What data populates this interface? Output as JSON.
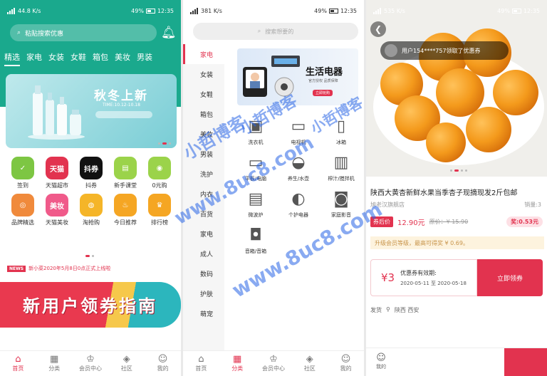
{
  "status": {
    "net": "4G",
    "speed": "44.8 K/s",
    "battery": "49%",
    "time": "12:35",
    "p2_speed": "381 K/s",
    "p3_speed": "535 K/s"
  },
  "home": {
    "search_placeholder": "粘贴搜索优惠",
    "categories": [
      "精选",
      "家电",
      "女装",
      "女鞋",
      "箱包",
      "美妆",
      "男装"
    ],
    "banner_title": "秋冬上新",
    "banner_sub": "TIME:10.12-10.18",
    "icons": [
      {
        "label": "签到",
        "glyph": "✓",
        "color": "#7dc643"
      },
      {
        "label": "天猫超市",
        "glyph": "天猫",
        "color": "#e2334f"
      },
      {
        "label": "抖券",
        "glyph": "抖券",
        "color": "#111111"
      },
      {
        "label": "新手课堂",
        "glyph": "▤",
        "color": "#9bd34a"
      },
      {
        "label": "0元购",
        "glyph": "◉",
        "color": "#9bd34a"
      },
      {
        "label": "品牌精选",
        "glyph": "◎",
        "color": "#f08a3c"
      },
      {
        "label": "天猫美妆",
        "glyph": "美妆",
        "color": "#f05a8a"
      },
      {
        "label": "淘抢购",
        "glyph": "◍",
        "color": "#f5b528"
      },
      {
        "label": "今日推荐",
        "glyph": "♨",
        "color": "#f5a623"
      },
      {
        "label": "排行榜",
        "glyph": "♛",
        "color": "#f5a623"
      }
    ],
    "news_badge": "NEWS",
    "news_text": "新小菜2020年5月8日0点正式上线啦",
    "guide_banner": "新用户领券指南"
  },
  "tabs": [
    {
      "label": "首页",
      "icon": "home-icon",
      "glyph": "⌂"
    },
    {
      "label": "分类",
      "icon": "grid-icon",
      "glyph": "▦"
    },
    {
      "label": "会员中心",
      "icon": "crown-icon",
      "glyph": "♔"
    },
    {
      "label": "社区",
      "icon": "community-icon",
      "glyph": "◈"
    },
    {
      "label": "我的",
      "icon": "user-icon",
      "glyph": "☺"
    }
  ],
  "category": {
    "search_placeholder": "搜索想要的",
    "sidebar": [
      "家电",
      "女装",
      "女鞋",
      "箱包",
      "美妆",
      "男装",
      "洗护",
      "内衣",
      "百货",
      "家电",
      "成人",
      "数码",
      "护肤",
      "萌宠"
    ],
    "banner_title": "生活电器",
    "banner_sub": "官方授权 品质保障",
    "banner_button": "立即抢购",
    "products": [
      {
        "label": "洗衣机",
        "glyph": "▣"
      },
      {
        "label": "电视机",
        "glyph": "▭"
      },
      {
        "label": "冰箱",
        "glyph": "▯"
      },
      {
        "label": "平板/电脑",
        "glyph": "▭"
      },
      {
        "label": "养生/水壶",
        "glyph": "◒"
      },
      {
        "label": "榨汁/搅拌机",
        "glyph": "▥"
      },
      {
        "label": "微波炉",
        "glyph": "▤"
      },
      {
        "label": "个护电器",
        "glyph": "◐"
      },
      {
        "label": "家庭影音",
        "glyph": "◙"
      },
      {
        "label": "音箱/音箱",
        "glyph": "◘"
      }
    ]
  },
  "detail": {
    "toast": "用户154****757领取了优惠券",
    "title": "陕西大黄杏新鲜水果当季杏子现摘现发2斤包邮",
    "shop": "旭老汉旗舰店",
    "sold": "销量:3",
    "price_tag": "券后价",
    "price_now": "12.90元",
    "price_old": "原价：¥ 15.90",
    "reward": "奖:0.53元",
    "upgrade": "升级会员等级，最高可得奖 ¥ 0.69。",
    "coupon_amount": "¥3",
    "coupon_label": "优惠券有效期:",
    "coupon_dates": "2020-05-11 至 2020-05-18",
    "coupon_button": "立即领券",
    "ship_label": "发货",
    "ship_place": "陕西 西安",
    "home_label": "我的"
  },
  "watermark": {
    "brand": "小哲博客",
    "url": "www.8uc8.com"
  },
  "colors": {
    "accent": "#e2334f",
    "teal": "#1aa98d"
  }
}
